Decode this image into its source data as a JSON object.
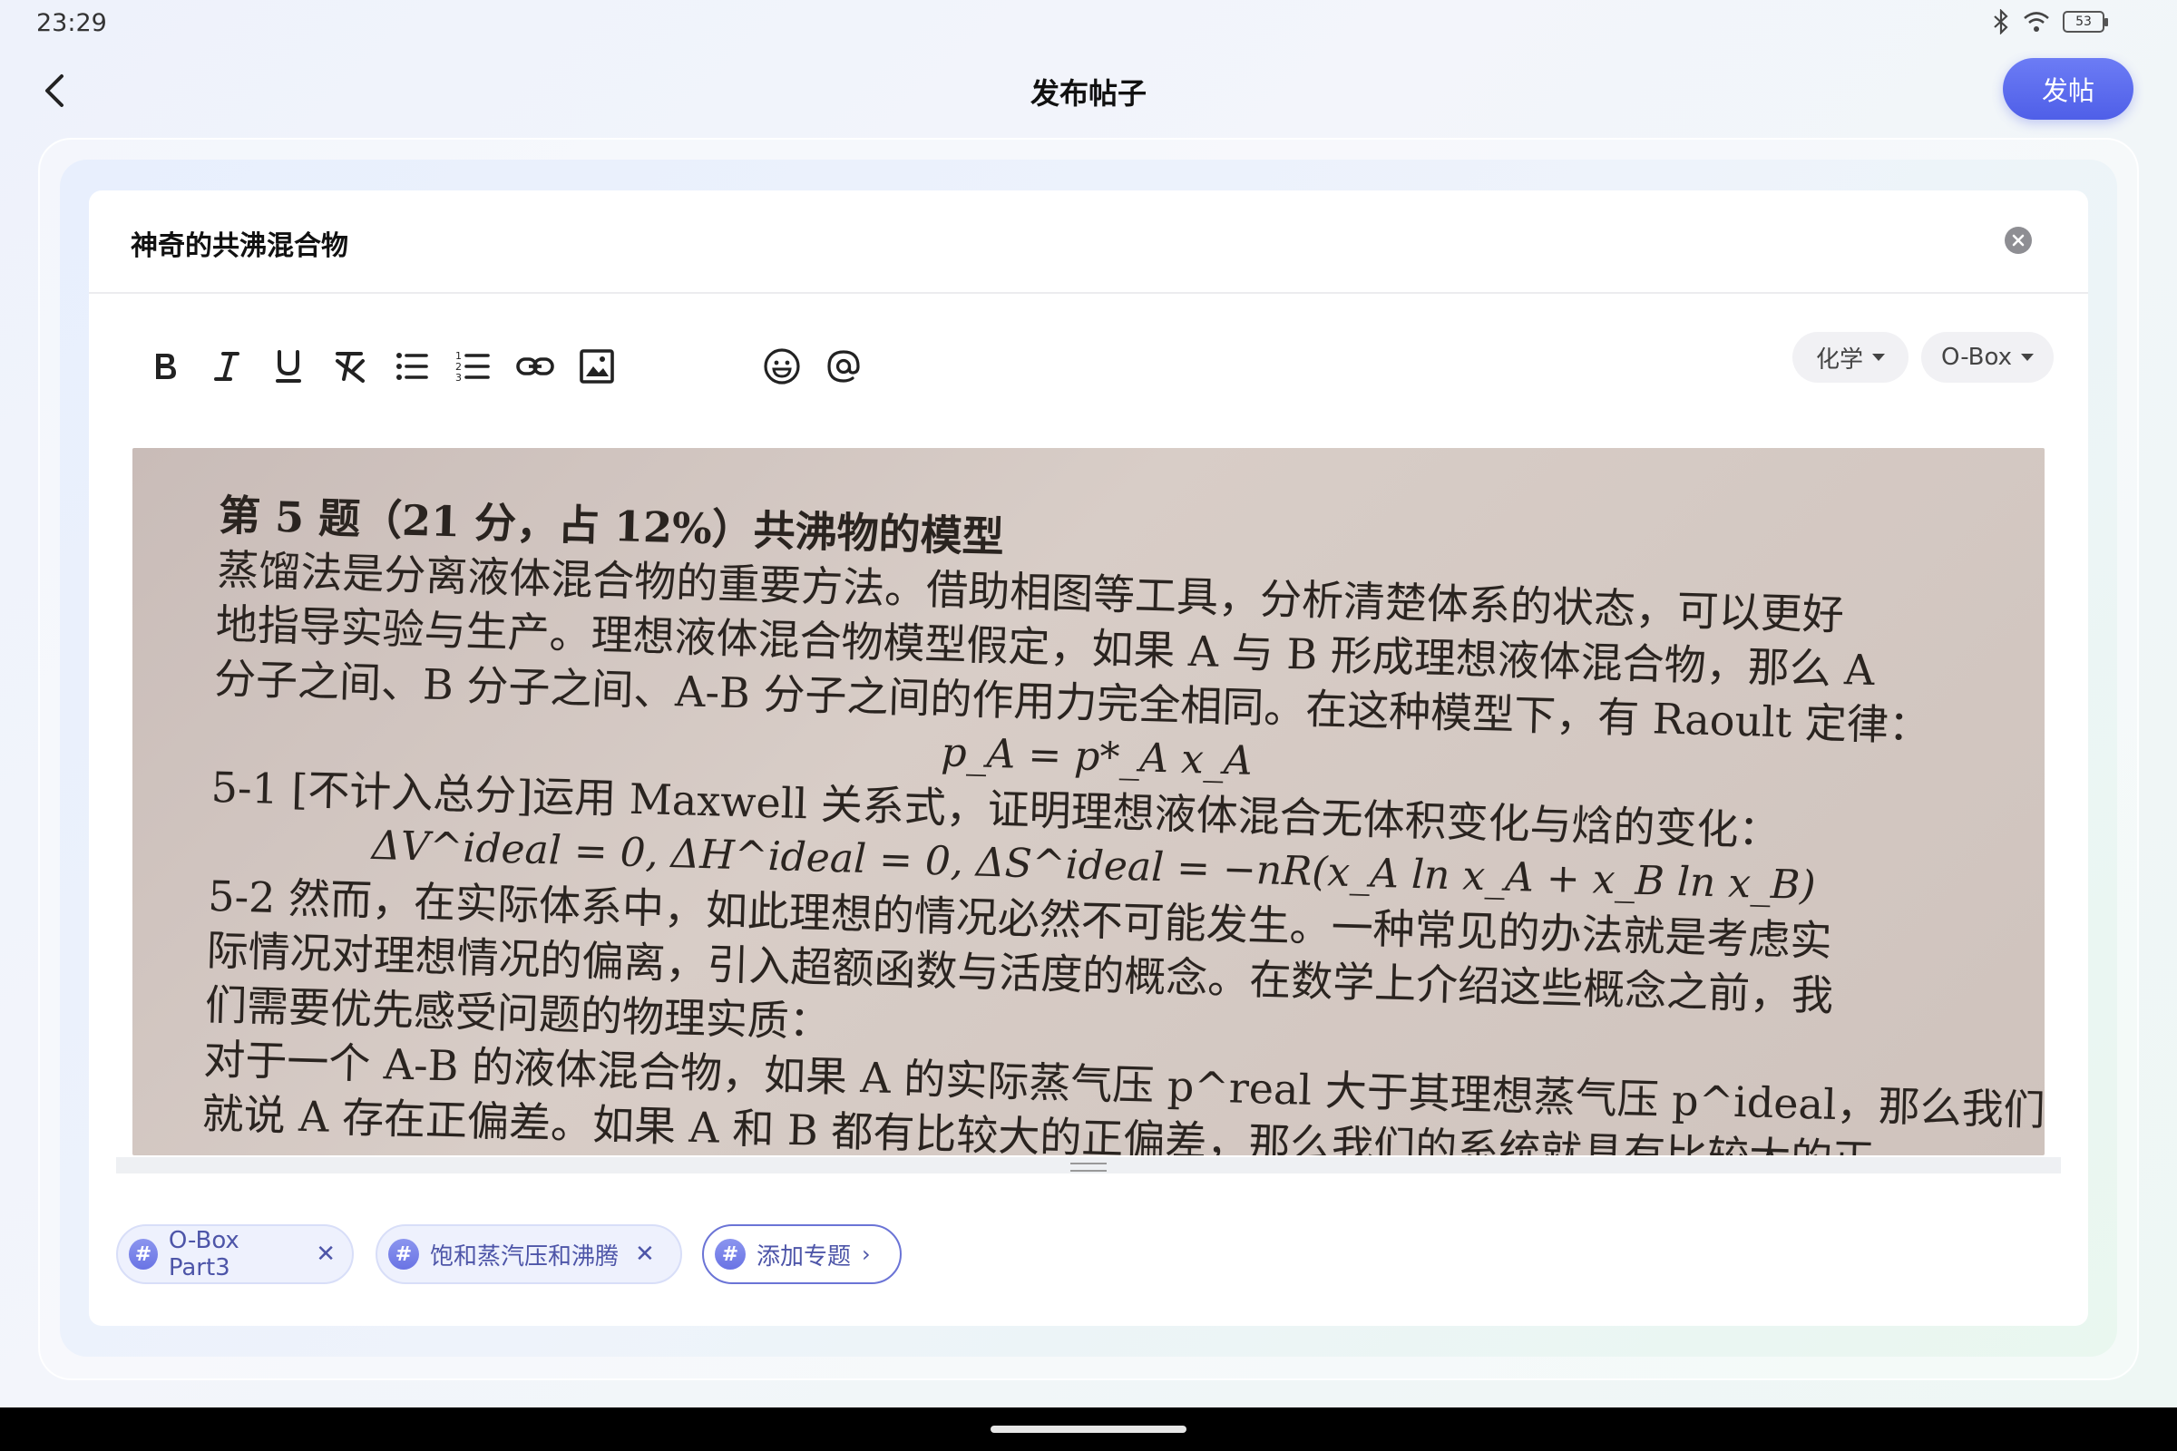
{
  "status": {
    "time": "23:29",
    "battery": "53"
  },
  "header": {
    "title": "发布帖子",
    "post_label": "发帖"
  },
  "post": {
    "title": "神奇的共沸混合物",
    "category": "化学",
    "board": "O-Box"
  },
  "toolbar": {
    "tools": [
      "bold-icon",
      "italic-icon",
      "underline-icon",
      "clear-format-icon",
      "bullet-list-icon",
      "numbered-list-icon",
      "link-icon",
      "image-icon",
      "emoji-icon",
      "mention-icon"
    ]
  },
  "image_content": {
    "lines": [
      "第 5 题（21 分，占 12%）共沸物的模型",
      "蒸馏法是分离液体混合物的重要方法。借助相图等工具，分析清楚体系的状态，可以更好",
      "地指导实验与生产。理想液体混合物模型假定，如果 A 与 B 形成理想液体混合物，那么 A",
      "分子之间、B 分子之间、A-B 分子之间的作用力完全相同。在这种模型下，有 Raoult 定律：",
      "p_A = p*_A x_A",
      "5-1 [不计入总分]运用 Maxwell 关系式，证明理想液体混合无体积变化与焓的变化：",
      "ΔV^ideal = 0, ΔH^ideal = 0, ΔS^ideal = −nR(x_A ln x_A + x_B ln x_B)",
      "5-2 然而，在实际体系中，如此理想的情况必然不可能发生。一种常见的办法就是考虑实",
      "际情况对理想情况的偏离，引入超额函数与活度的概念。在数学上介绍这些概念之前，我",
      "们需要优先感受问题的物理实质：",
      "对于一个 A-B 的液体混合物，如果 A 的实际蒸气压 p^real 大于其理想蒸气压 p^ideal，那么我们",
      "就说 A 存在正偏差。如果 A 和 B 都有比较大的正偏差，那么我们的系统就具有比较大的正"
    ]
  },
  "tags": [
    {
      "label": "O-Box Part3",
      "removable": true
    },
    {
      "label": "饱和蒸汽压和沸腾",
      "removable": true
    }
  ],
  "add_topic_label": "添加专题"
}
